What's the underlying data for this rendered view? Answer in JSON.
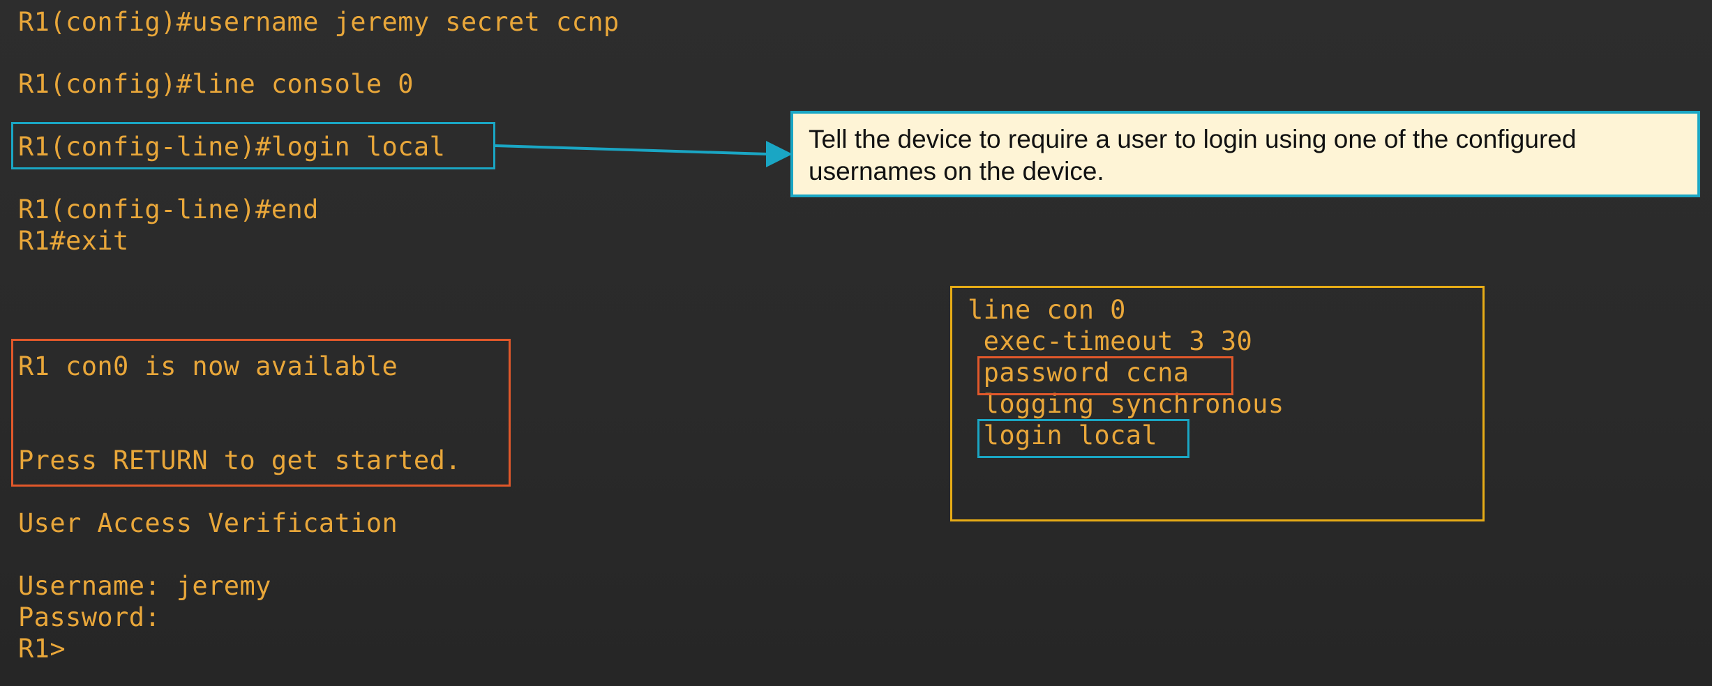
{
  "terminal": {
    "lines": [
      "R1(config)#username jeremy secret ccnp",
      "R1(config)#line console 0",
      "R1(config-line)#login local",
      "R1(config-line)#end",
      "R1#exit",
      "R1 con0 is now available",
      "Press RETURN to get started.",
      "User Access Verification",
      "Username: jeremy",
      "Password:",
      "R1>"
    ]
  },
  "callout": {
    "text": "Tell the device to require a user to login using one of the configured usernames on the device."
  },
  "config_block": {
    "lines": [
      "line con 0",
      " exec-timeout 3 30",
      " password ccna",
      " logging synchronous",
      " login local"
    ]
  },
  "colors": {
    "background": "#2b2b2b",
    "terminal_text": "#e9a73a",
    "highlight_cyan": "#1aa6c4",
    "highlight_orange": "#e2582a",
    "highlight_yellow": "#e7ac16",
    "callout_background": "#fef4d6"
  }
}
